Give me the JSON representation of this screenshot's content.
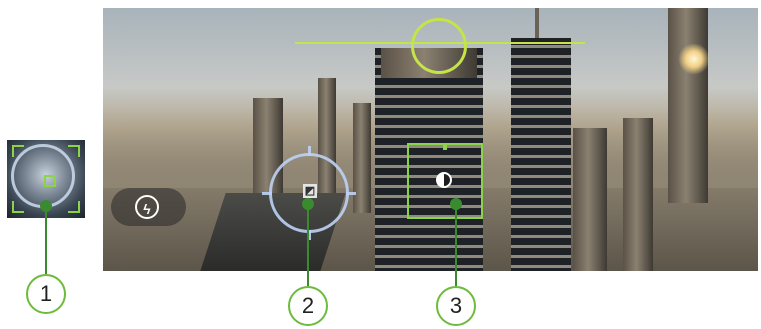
{
  "callouts": [
    {
      "number": "1"
    },
    {
      "number": "2"
    },
    {
      "number": "3"
    }
  ],
  "icons": {
    "flash": "flash-off-icon",
    "focus_mode": "focus-mode-icon",
    "exposure": "exposure-icon"
  },
  "colors": {
    "level_indicator": "#c6e34a",
    "exposure_box": "#8bd348",
    "focus_ring": "#bed2f5",
    "callout_border": "#6dbb3c",
    "leader_line": "#3a8a2f"
  }
}
